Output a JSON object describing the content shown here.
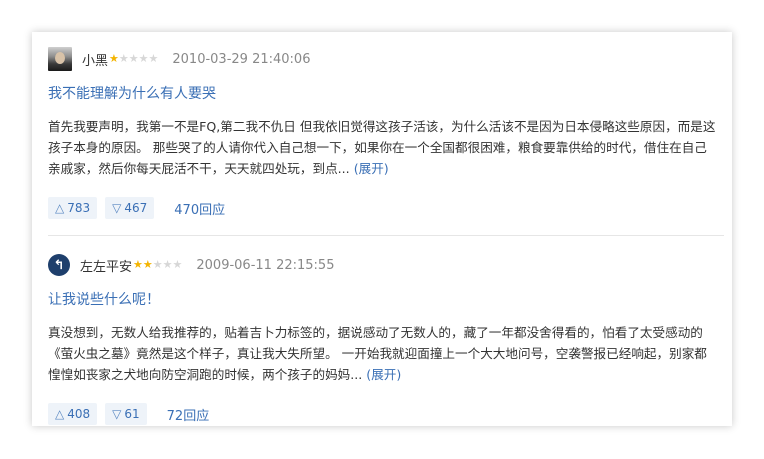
{
  "reviews": [
    {
      "author": "小黑",
      "rating": 1,
      "date": "2010-03-29 21:40:06",
      "title": "我不能理解为什么有人要哭",
      "body": "首先我要声明，我第一不是FQ,第二我不仇日 但我依旧觉得这孩子活该，为什么活该不是因为日本侵略这些原因，而是这孩子本身的原因。 那些哭了的人请你代入自己想一下，如果你在一个全国都很困难，粮食要靠供给的时代，借住在自己亲戚家，然后你每天屁活不干，天天就四处玩，到点...",
      "expand_label": "(展开)",
      "upvotes": "783",
      "downvotes": "467",
      "replies": "470回应"
    },
    {
      "author": "左左平安",
      "rating": 2,
      "date": "2009-06-11 22:15:55",
      "title": "让我说些什么呢！",
      "body": "真没想到，无数人给我推荐的，贴着吉卜力标签的，据说感动了无数人的，藏了一年都没舍得看的，怕看了太受感动的《萤火虫之墓》竟然是这个样子，真让我大失所望。 一开始我就迎面撞上一个大大地问号，空袭警报已经响起，别家都惶惶如丧家之犬地向防空洞跑的时候，两个孩子的妈妈...",
      "expand_label": "(展开)",
      "upvotes": "408",
      "downvotes": "61",
      "replies": "72回应"
    }
  ],
  "icons": {
    "upvote": "triangle-up-icon",
    "downvote": "triangle-down-icon",
    "star": "star-icon",
    "avatar_glyph": "↰"
  },
  "colors": {
    "link": "#3a6fb5",
    "star_on": "#f4b400",
    "star_off": "#d7d7d7",
    "vote_bg": "#eef3f9"
  }
}
